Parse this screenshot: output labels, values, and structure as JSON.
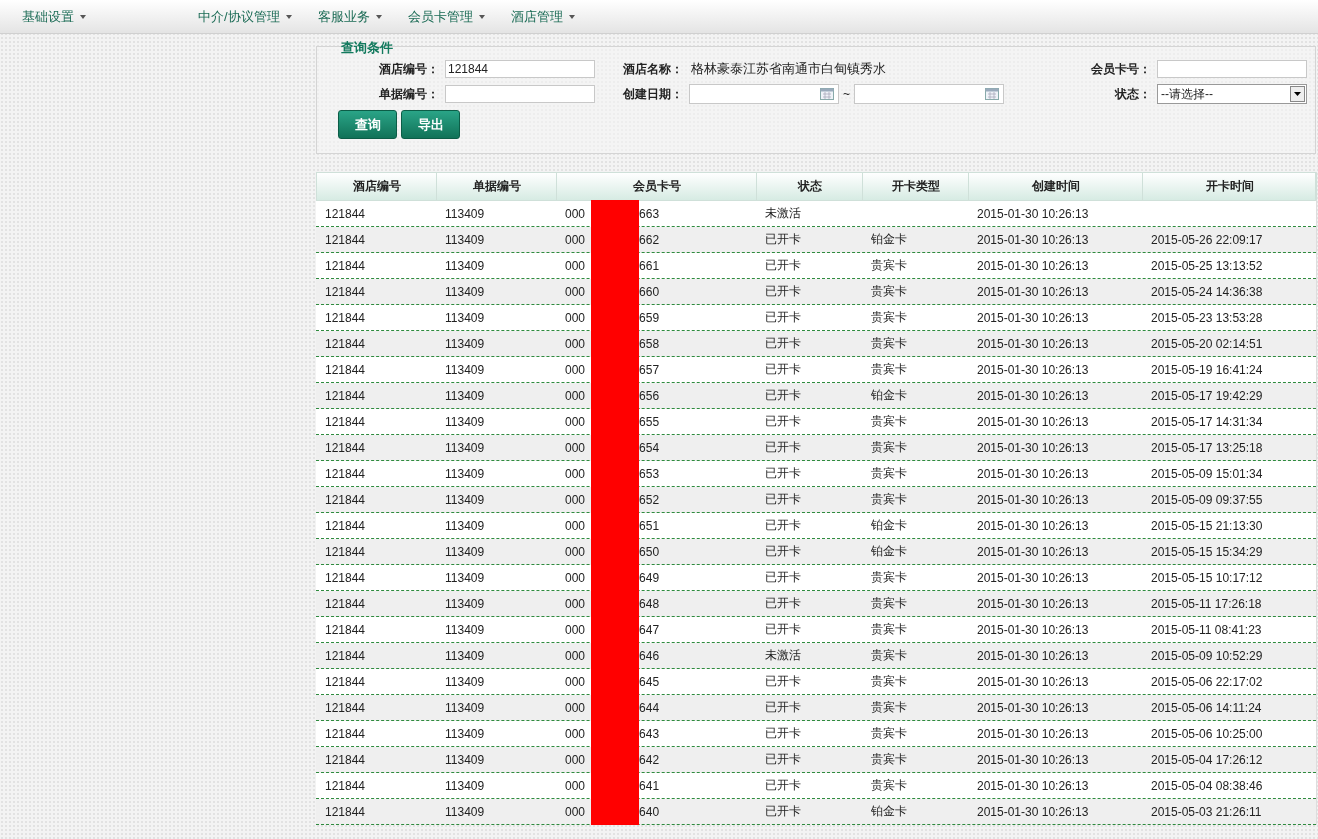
{
  "nav": [
    {
      "label": "基础设置"
    },
    {
      "label": "中介/协议管理"
    },
    {
      "label": "客服业务"
    },
    {
      "label": "会员卡管理"
    },
    {
      "label": "酒店管理"
    }
  ],
  "query": {
    "title": "查询条件",
    "fields": [
      {
        "kind": "text",
        "label": "酒店编号：",
        "value": "121844"
      },
      {
        "kind": "plain",
        "label": "酒店名称：",
        "value": "格林豪泰江苏省南通市白甸镇秀水"
      },
      {
        "kind": "text",
        "label": "会员卡号："
      },
      {
        "kind": "text",
        "label": "单据编号："
      },
      {
        "kind": "daterange",
        "label": "创建日期：",
        "separator": "~"
      },
      {
        "kind": "select",
        "label": "状态：",
        "value": "--请选择--"
      }
    ],
    "buttons": [
      "查询",
      "导出"
    ]
  },
  "table": {
    "columns": [
      "酒店编号",
      "单据编号",
      "会员卡号",
      "状态",
      "开卡类型",
      "创建时间",
      "开卡时间"
    ],
    "rows": [
      {
        "hotel": "121844",
        "doc": "113409",
        "card_prefix": "000",
        "card_suffix": "663",
        "status": "未激活",
        "type": "",
        "created": "2015-01-30 10:26:13",
        "opened": ""
      },
      {
        "hotel": "121844",
        "doc": "113409",
        "card_prefix": "000",
        "card_suffix": "662",
        "status": "已开卡",
        "type": "铂金卡",
        "created": "2015-01-30 10:26:13",
        "opened": "2015-05-26 22:09:17"
      },
      {
        "hotel": "121844",
        "doc": "113409",
        "card_prefix": "000",
        "card_suffix": "661",
        "status": "已开卡",
        "type": "贵宾卡",
        "created": "2015-01-30 10:26:13",
        "opened": "2015-05-25 13:13:52"
      },
      {
        "hotel": "121844",
        "doc": "113409",
        "card_prefix": "000",
        "card_suffix": "660",
        "status": "已开卡",
        "type": "贵宾卡",
        "created": "2015-01-30 10:26:13",
        "opened": "2015-05-24 14:36:38"
      },
      {
        "hotel": "121844",
        "doc": "113409",
        "card_prefix": "000",
        "card_suffix": "659",
        "status": "已开卡",
        "type": "贵宾卡",
        "created": "2015-01-30 10:26:13",
        "opened": "2015-05-23 13:53:28"
      },
      {
        "hotel": "121844",
        "doc": "113409",
        "card_prefix": "000",
        "card_suffix": "658",
        "status": "已开卡",
        "type": "贵宾卡",
        "created": "2015-01-30 10:26:13",
        "opened": "2015-05-20 02:14:51"
      },
      {
        "hotel": "121844",
        "doc": "113409",
        "card_prefix": "000",
        "card_suffix": "657",
        "status": "已开卡",
        "type": "贵宾卡",
        "created": "2015-01-30 10:26:13",
        "opened": "2015-05-19 16:41:24"
      },
      {
        "hotel": "121844",
        "doc": "113409",
        "card_prefix": "000",
        "card_suffix": "656",
        "status": "已开卡",
        "type": "铂金卡",
        "created": "2015-01-30 10:26:13",
        "opened": "2015-05-17 19:42:29"
      },
      {
        "hotel": "121844",
        "doc": "113409",
        "card_prefix": "000",
        "card_suffix": "655",
        "status": "已开卡",
        "type": "贵宾卡",
        "created": "2015-01-30 10:26:13",
        "opened": "2015-05-17 14:31:34"
      },
      {
        "hotel": "121844",
        "doc": "113409",
        "card_prefix": "000",
        "card_suffix": "654",
        "status": "已开卡",
        "type": "贵宾卡",
        "created": "2015-01-30 10:26:13",
        "opened": "2015-05-17 13:25:18"
      },
      {
        "hotel": "121844",
        "doc": "113409",
        "card_prefix": "000",
        "card_suffix": "653",
        "status": "已开卡",
        "type": "贵宾卡",
        "created": "2015-01-30 10:26:13",
        "opened": "2015-05-09 15:01:34"
      },
      {
        "hotel": "121844",
        "doc": "113409",
        "card_prefix": "000",
        "card_suffix": "652",
        "status": "已开卡",
        "type": "贵宾卡",
        "created": "2015-01-30 10:26:13",
        "opened": "2015-05-09 09:37:55"
      },
      {
        "hotel": "121844",
        "doc": "113409",
        "card_prefix": "000",
        "card_suffix": "651",
        "status": "已开卡",
        "type": "铂金卡",
        "created": "2015-01-30 10:26:13",
        "opened": "2015-05-15 21:13:30"
      },
      {
        "hotel": "121844",
        "doc": "113409",
        "card_prefix": "000",
        "card_suffix": "650",
        "status": "已开卡",
        "type": "铂金卡",
        "created": "2015-01-30 10:26:13",
        "opened": "2015-05-15 15:34:29"
      },
      {
        "hotel": "121844",
        "doc": "113409",
        "card_prefix": "000",
        "card_suffix": "649",
        "status": "已开卡",
        "type": "贵宾卡",
        "created": "2015-01-30 10:26:13",
        "opened": "2015-05-15 10:17:12"
      },
      {
        "hotel": "121844",
        "doc": "113409",
        "card_prefix": "000",
        "card_suffix": "648",
        "status": "已开卡",
        "type": "贵宾卡",
        "created": "2015-01-30 10:26:13",
        "opened": "2015-05-11 17:26:18"
      },
      {
        "hotel": "121844",
        "doc": "113409",
        "card_prefix": "000",
        "card_suffix": "647",
        "status": "已开卡",
        "type": "贵宾卡",
        "created": "2015-01-30 10:26:13",
        "opened": "2015-05-11 08:41:23"
      },
      {
        "hotel": "121844",
        "doc": "113409",
        "card_prefix": "000",
        "card_suffix": "646",
        "status": "未激活",
        "type": "贵宾卡",
        "created": "2015-01-30 10:26:13",
        "opened": "2015-05-09 10:52:29"
      },
      {
        "hotel": "121844",
        "doc": "113409",
        "card_prefix": "000",
        "card_suffix": "645",
        "status": "已开卡",
        "type": "贵宾卡",
        "created": "2015-01-30 10:26:13",
        "opened": "2015-05-06 22:17:02"
      },
      {
        "hotel": "121844",
        "doc": "113409",
        "card_prefix": "000",
        "card_suffix": "644",
        "status": "已开卡",
        "type": "贵宾卡",
        "created": "2015-01-30 10:26:13",
        "opened": "2015-05-06 14:11:24"
      },
      {
        "hotel": "121844",
        "doc": "113409",
        "card_prefix": "000",
        "card_suffix": "643",
        "status": "已开卡",
        "type": "贵宾卡",
        "created": "2015-01-30 10:26:13",
        "opened": "2015-05-06 10:25:00"
      },
      {
        "hotel": "121844",
        "doc": "113409",
        "card_prefix": "000",
        "card_suffix": "642",
        "status": "已开卡",
        "type": "贵宾卡",
        "created": "2015-01-30 10:26:13",
        "opened": "2015-05-04 17:26:12"
      },
      {
        "hotel": "121844",
        "doc": "113409",
        "card_prefix": "000",
        "card_suffix": "641",
        "status": "已开卡",
        "type": "贵宾卡",
        "created": "2015-01-30 10:26:13",
        "opened": "2015-05-04 08:38:46"
      },
      {
        "hotel": "121844",
        "doc": "113409",
        "card_prefix": "000",
        "card_suffix": "640",
        "status": "已开卡",
        "type": "铂金卡",
        "created": "2015-01-30 10:26:13",
        "opened": "2015-05-03 21:26:11"
      }
    ]
  }
}
